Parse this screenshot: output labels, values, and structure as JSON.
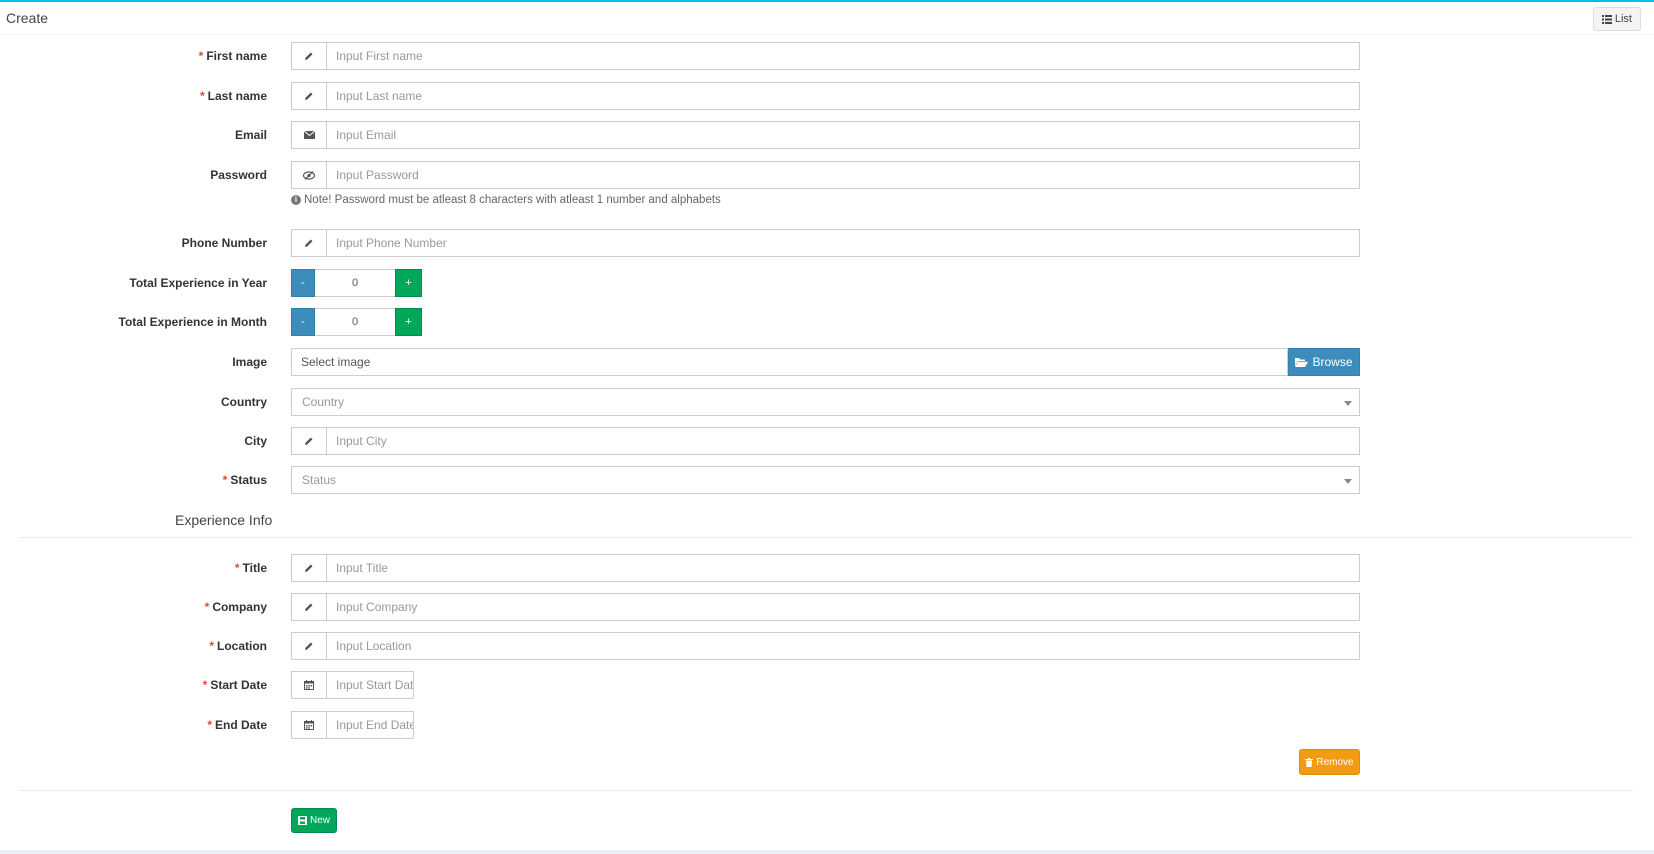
{
  "header": {
    "title": "Create",
    "list_label": "List"
  },
  "fields": {
    "first_name": {
      "label": "First name",
      "required": true,
      "placeholder": "Input First name"
    },
    "last_name": {
      "label": "Last name",
      "required": true,
      "placeholder": "Input Last name"
    },
    "email": {
      "label": "Email",
      "placeholder": "Input Email"
    },
    "password": {
      "label": "Password",
      "placeholder": "Input Password",
      "note": "Note! Password must be atleast 8 characters with atleast 1 number and alphabets"
    },
    "phone": {
      "label": "Phone Number",
      "placeholder": "Input Phone Number"
    },
    "exp_year": {
      "label": "Total Experience in Year",
      "value": "0",
      "minus": "-",
      "plus": "+"
    },
    "exp_month": {
      "label": "Total Experience in Month",
      "value": "0",
      "minus": "-",
      "plus": "+"
    },
    "image": {
      "label": "Image",
      "placeholder": "Select image",
      "browse_label": "Browse"
    },
    "country": {
      "label": "Country",
      "placeholder": "Country"
    },
    "city": {
      "label": "City",
      "placeholder": "Input City"
    },
    "status": {
      "label": "Status",
      "required": true,
      "placeholder": "Status"
    }
  },
  "experience": {
    "section_title": "Experience Info",
    "title": {
      "label": "Title",
      "placeholder": "Input Title"
    },
    "company": {
      "label": "Company",
      "placeholder": "Input Company"
    },
    "location": {
      "label": "Location",
      "placeholder": "Input Location"
    },
    "start_date": {
      "label": "Start Date",
      "placeholder": "Input Start Dat"
    },
    "end_date": {
      "label": "End Date",
      "placeholder": "Input End Date"
    },
    "remove_label": "Remove"
  },
  "footer": {
    "new_label": "New"
  },
  "required_mark": "*",
  "colors": {
    "accent": "#00c0ef",
    "primary": "#3c8dbc",
    "success": "#00a65a",
    "warning": "#f39c12",
    "required": "#dd4b39"
  }
}
